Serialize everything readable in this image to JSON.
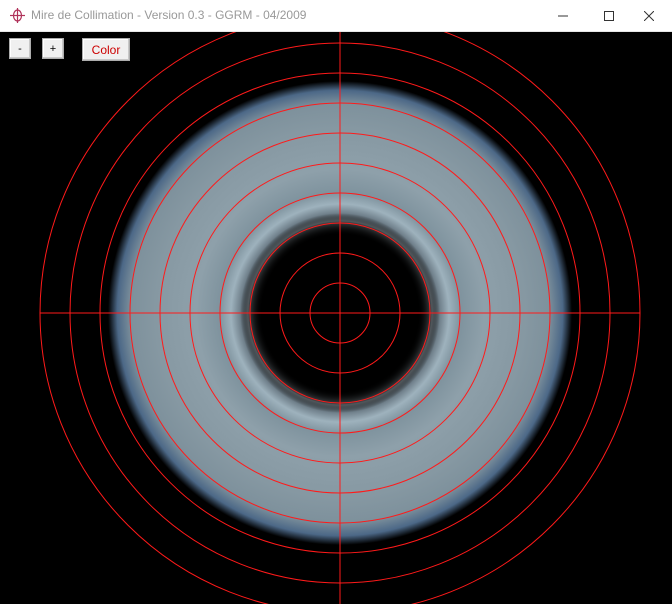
{
  "window": {
    "title": "Mire de Collimation - Version 0.3 - GGRM - 04/2009",
    "app_icon": "crosshair-target-icon",
    "controls": [
      "minimize-icon",
      "maximize-icon",
      "close-icon"
    ]
  },
  "toolbar": {
    "zoom_out_label": "-",
    "zoom_in_label": "+",
    "color_label": "Color"
  },
  "reticle": {
    "line_color": "#ff1a1a",
    "ring_count": 10,
    "crosshair": true
  },
  "colors": {
    "background": "#000000",
    "titlebar": "#ffffff",
    "title_text": "#999999",
    "color_button_text": "#cc0000"
  }
}
